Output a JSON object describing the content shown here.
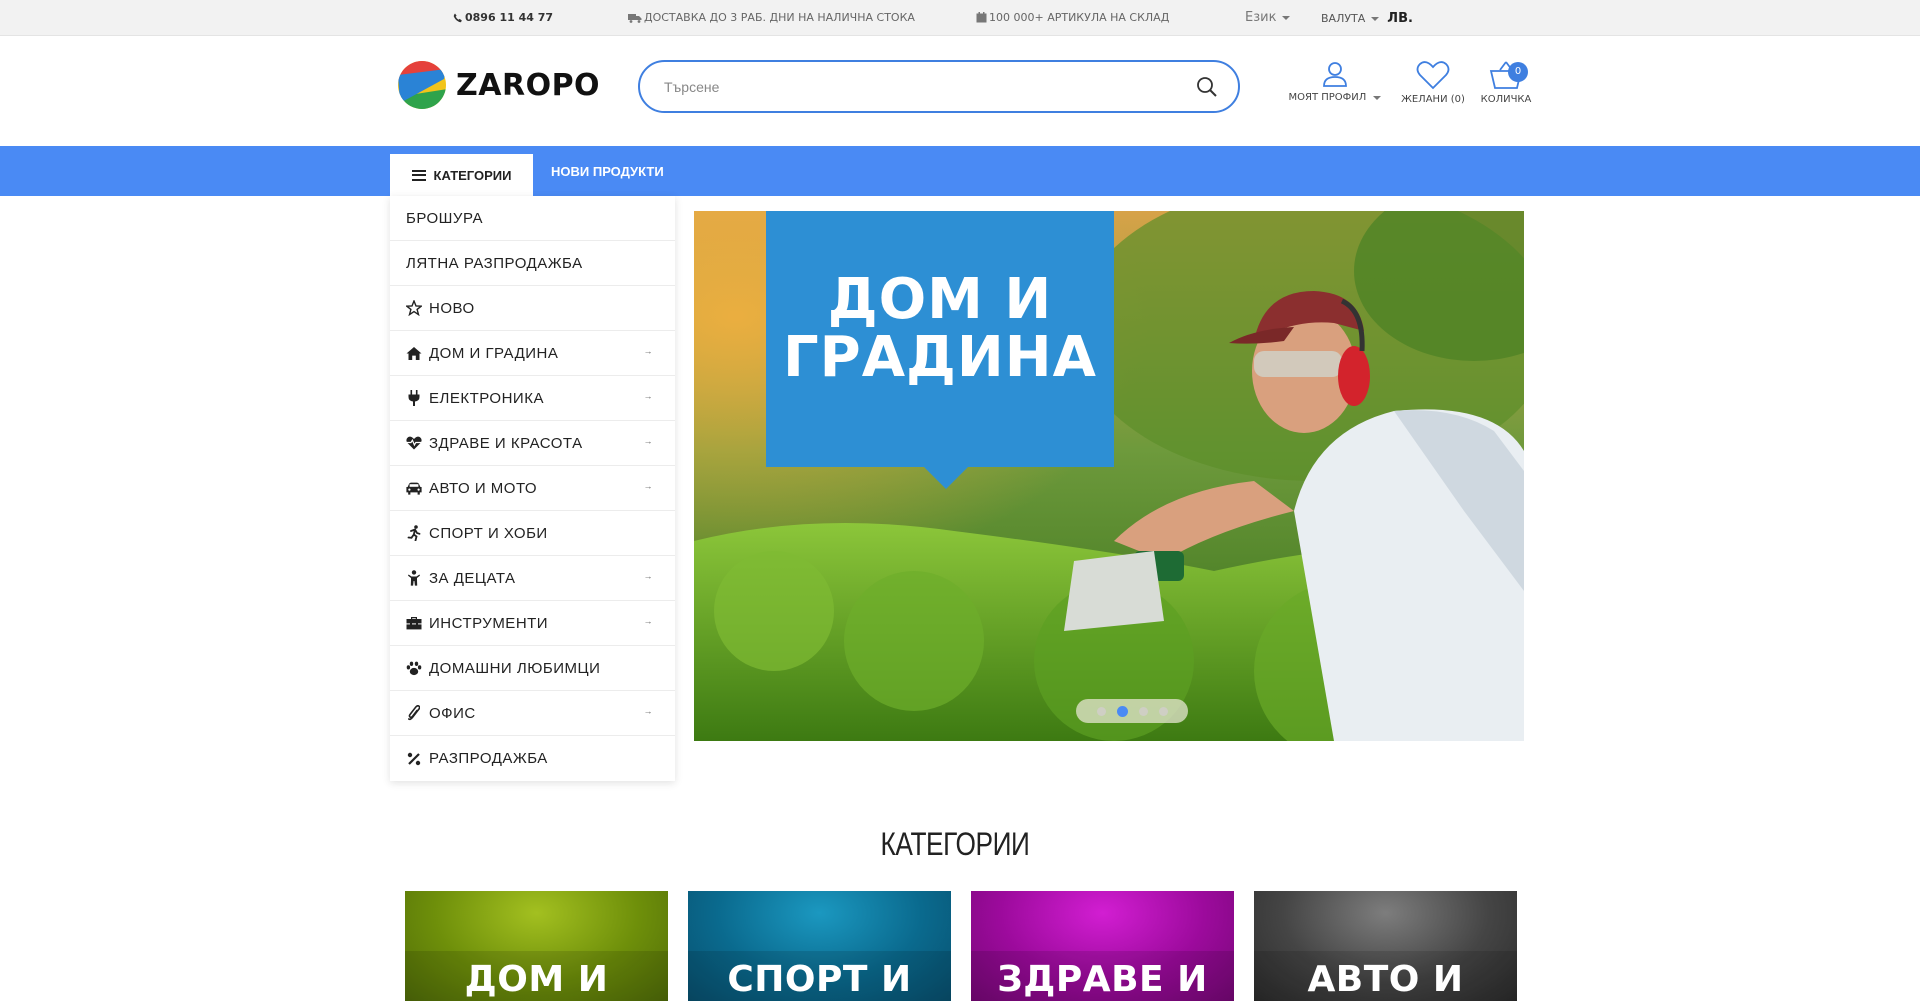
{
  "topbar": {
    "phone": "0896 11 44 77",
    "delivery": "ДОСТАВКА ДО 3 РАБ. ДНИ НА НАЛИЧНА СТОКА",
    "stock": "100 000+ АРТИКУЛА НА СКЛАД",
    "language_label": "Език",
    "currency_label": "ВАЛУТА",
    "currency_value": "ЛВ."
  },
  "header": {
    "logo_text": "ZAROPO",
    "search_placeholder": "Търсене",
    "profile_label": "МОЯТ ПРОФИЛ",
    "wishlist_label": "ЖЕЛАНИ (0)",
    "cart_label": "КОЛИЧКА",
    "cart_count": "0"
  },
  "nav": {
    "categories_label": "КАТЕГОРИИ",
    "new_products_label": "НОВИ ПРОДУКТИ"
  },
  "sidebar": {
    "items": [
      {
        "label": "БРОШУРА",
        "icon": "none",
        "has_arrow": false
      },
      {
        "label": "ЛЯТНА РАЗПРОДАЖБА",
        "icon": "none",
        "has_arrow": false
      },
      {
        "label": "НОВО",
        "icon": "star-icon",
        "has_arrow": false
      },
      {
        "label": "ДОМ И ГРАДИНА",
        "icon": "home-icon",
        "has_arrow": true
      },
      {
        "label": "ЕЛЕКТРОНИКА",
        "icon": "plug-icon",
        "has_arrow": true
      },
      {
        "label": "ЗДРАВЕ И КРАСОТА",
        "icon": "heartbeat-icon",
        "has_arrow": true
      },
      {
        "label": "АВТО И МОТО",
        "icon": "car-icon",
        "has_arrow": true
      },
      {
        "label": "СПОРТ И ХОБИ",
        "icon": "running-icon",
        "has_arrow": false
      },
      {
        "label": "ЗА ДЕЦАТА",
        "icon": "child-icon",
        "has_arrow": true
      },
      {
        "label": "ИНСТРУМЕНТИ",
        "icon": "toolbox-icon",
        "has_arrow": true
      },
      {
        "label": "ДОМАШНИ ЛЮБИМЦИ",
        "icon": "paw-icon",
        "has_arrow": false
      },
      {
        "label": "ОФИС",
        "icon": "paperclip-icon",
        "has_arrow": true
      },
      {
        "label": "РАЗПРОДАЖБА",
        "icon": "percent-icon",
        "has_arrow": false
      }
    ]
  },
  "slider": {
    "banner_text": "ДОМ И ГРАДИНА",
    "slide_count": 4,
    "active_slide": 2
  },
  "categories": {
    "heading": "КАТЕГОРИИ",
    "tiles": [
      "ДОМ И",
      "СПОРТ И",
      "ЗДРАВЕ И",
      "АВТО И"
    ]
  },
  "colors": {
    "accent": "#4a8af4",
    "search_border": "#3f7fe0",
    "banner": "#2d8fd4"
  }
}
